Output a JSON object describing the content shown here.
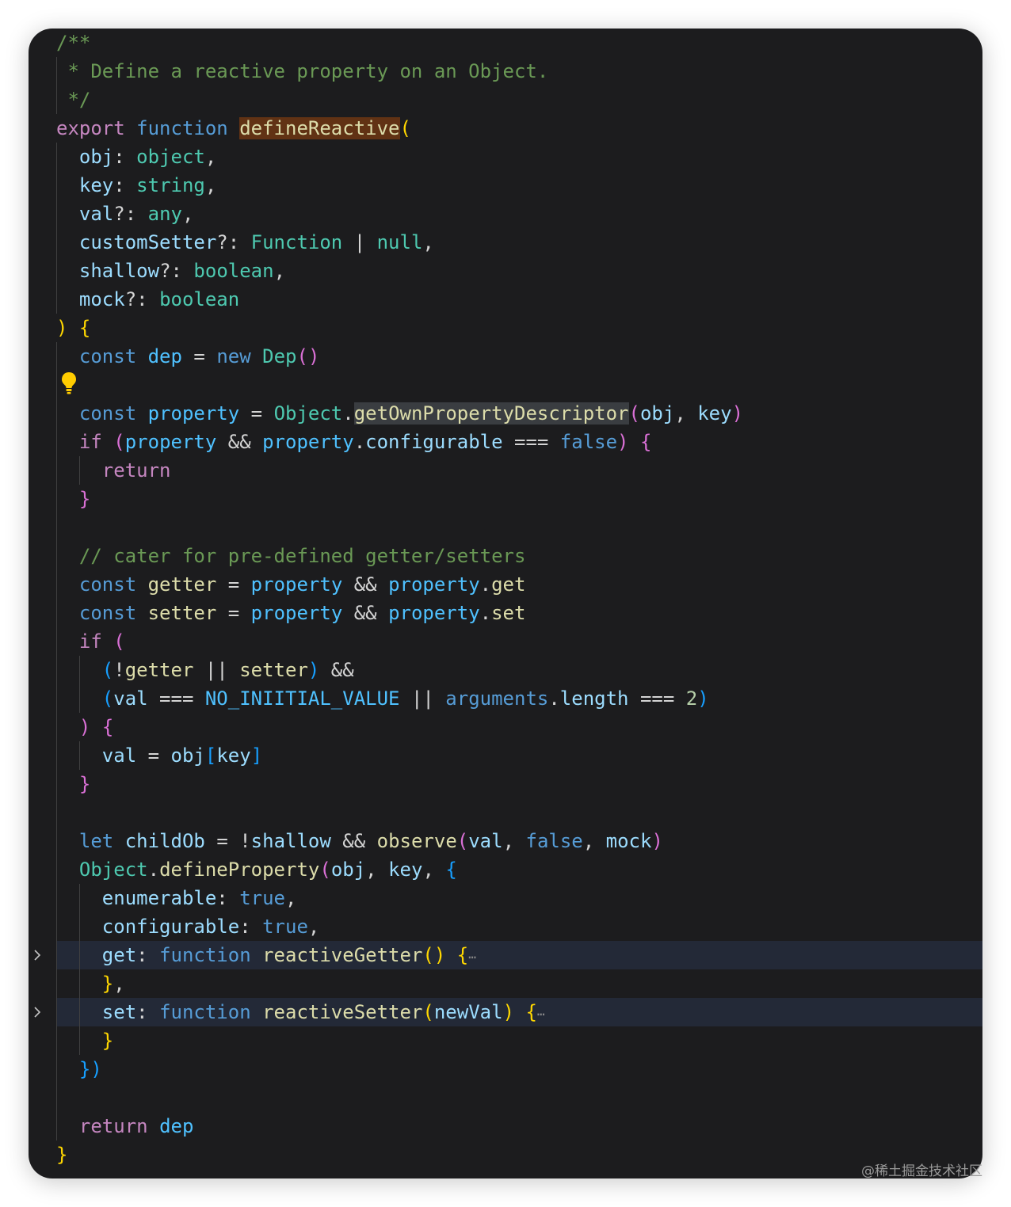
{
  "editor": {
    "background": "#1c1c1e",
    "lines": [
      [
        [
          "/**",
          "cm"
        ]
      ],
      [
        [
          " * Define a reactive property on an Object.",
          "cm"
        ]
      ],
      [
        [
          " */",
          "cm"
        ]
      ],
      [
        [
          "export",
          "kw"
        ],
        [
          " ",
          "pu"
        ],
        [
          "function",
          "st"
        ],
        [
          " ",
          "pu"
        ],
        [
          "defineReactive",
          "fn hl-def"
        ],
        [
          "(",
          "b1"
        ]
      ],
      [
        [
          "  ",
          "pu"
        ],
        [
          "obj",
          "vr"
        ],
        [
          ": ",
          "pu"
        ],
        [
          "object",
          "ty"
        ],
        [
          ",",
          "pu"
        ]
      ],
      [
        [
          "  ",
          "pu"
        ],
        [
          "key",
          "vr"
        ],
        [
          ": ",
          "pu"
        ],
        [
          "string",
          "ty"
        ],
        [
          ",",
          "pu"
        ]
      ],
      [
        [
          "  ",
          "pu"
        ],
        [
          "val",
          "vr"
        ],
        [
          "?: ",
          "pu"
        ],
        [
          "any",
          "ty"
        ],
        [
          ",",
          "pu"
        ]
      ],
      [
        [
          "  ",
          "pu"
        ],
        [
          "customSetter",
          "vr"
        ],
        [
          "?: ",
          "pu"
        ],
        [
          "Function",
          "ty"
        ],
        [
          " | ",
          "pu"
        ],
        [
          "null",
          "ty"
        ],
        [
          ",",
          "pu"
        ]
      ],
      [
        [
          "  ",
          "pu"
        ],
        [
          "shallow",
          "vr"
        ],
        [
          "?: ",
          "pu"
        ],
        [
          "boolean",
          "ty"
        ],
        [
          ",",
          "pu"
        ]
      ],
      [
        [
          "  ",
          "pu"
        ],
        [
          "mock",
          "vr"
        ],
        [
          "?: ",
          "pu"
        ],
        [
          "boolean",
          "ty"
        ]
      ],
      [
        [
          ")",
          "b1"
        ],
        [
          " ",
          "pu"
        ],
        [
          "{",
          "b1"
        ]
      ],
      [
        [
          "  ",
          "pu"
        ],
        [
          "const",
          "st"
        ],
        [
          " ",
          "pu"
        ],
        [
          "dep",
          "cn"
        ],
        [
          " = ",
          "pu"
        ],
        [
          "new",
          "st"
        ],
        [
          " ",
          "pu"
        ],
        [
          "Dep",
          "ty"
        ],
        [
          "()",
          "b2"
        ]
      ],
      [],
      [
        [
          "  ",
          "pu"
        ],
        [
          "const",
          "st"
        ],
        [
          " ",
          "pu"
        ],
        [
          "property",
          "cn"
        ],
        [
          " = ",
          "pu"
        ],
        [
          "Object",
          "ty"
        ],
        [
          ".",
          "pu"
        ],
        [
          "getOwnPropertyDescriptor",
          "fn hl-sel"
        ],
        [
          "(",
          "b2"
        ],
        [
          "obj",
          "vr"
        ],
        [
          ", ",
          "pu"
        ],
        [
          "key",
          "vr"
        ],
        [
          ")",
          "b2"
        ]
      ],
      [
        [
          "  ",
          "pu"
        ],
        [
          "if",
          "kw"
        ],
        [
          " ",
          "pu"
        ],
        [
          "(",
          "b2"
        ],
        [
          "property",
          "cn"
        ],
        [
          " && ",
          "pu"
        ],
        [
          "property",
          "cn"
        ],
        [
          ".",
          "pu"
        ],
        [
          "configurable",
          "vr"
        ],
        [
          " === ",
          "pu"
        ],
        [
          "false",
          "st"
        ],
        [
          ")",
          "b2"
        ],
        [
          " ",
          "pu"
        ],
        [
          "{",
          "b2"
        ]
      ],
      [
        [
          "    ",
          "pu"
        ],
        [
          "return",
          "kw"
        ]
      ],
      [
        [
          "  ",
          "pu"
        ],
        [
          "}",
          "b2"
        ]
      ],
      [],
      [
        [
          "  ",
          "pu"
        ],
        [
          "// cater for pre-defined getter/setters",
          "cm"
        ]
      ],
      [
        [
          "  ",
          "pu"
        ],
        [
          "const",
          "st"
        ],
        [
          " ",
          "pu"
        ],
        [
          "getter",
          "fn"
        ],
        [
          " = ",
          "pu"
        ],
        [
          "property",
          "cn"
        ],
        [
          " && ",
          "pu"
        ],
        [
          "property",
          "cn"
        ],
        [
          ".",
          "pu"
        ],
        [
          "get",
          "fn"
        ]
      ],
      [
        [
          "  ",
          "pu"
        ],
        [
          "const",
          "st"
        ],
        [
          " ",
          "pu"
        ],
        [
          "setter",
          "fn"
        ],
        [
          " = ",
          "pu"
        ],
        [
          "property",
          "cn"
        ],
        [
          " && ",
          "pu"
        ],
        [
          "property",
          "cn"
        ],
        [
          ".",
          "pu"
        ],
        [
          "set",
          "fn"
        ]
      ],
      [
        [
          "  ",
          "pu"
        ],
        [
          "if",
          "kw"
        ],
        [
          " ",
          "pu"
        ],
        [
          "(",
          "b2"
        ]
      ],
      [
        [
          "    ",
          "pu"
        ],
        [
          "(",
          "b3"
        ],
        [
          "!",
          "pu"
        ],
        [
          "getter",
          "fn"
        ],
        [
          " || ",
          "pu"
        ],
        [
          "setter",
          "fn"
        ],
        [
          ")",
          "b3"
        ],
        [
          " &&",
          "pu"
        ]
      ],
      [
        [
          "    ",
          "pu"
        ],
        [
          "(",
          "b3"
        ],
        [
          "val",
          "vr"
        ],
        [
          " === ",
          "pu"
        ],
        [
          "NO_INIITIAL_VALUE",
          "cn"
        ],
        [
          " || ",
          "pu"
        ],
        [
          "arguments",
          "st"
        ],
        [
          ".",
          "pu"
        ],
        [
          "length",
          "vr"
        ],
        [
          " === ",
          "pu"
        ],
        [
          "2",
          "nu"
        ],
        [
          ")",
          "b3"
        ]
      ],
      [
        [
          "  ",
          "pu"
        ],
        [
          ")",
          "b2"
        ],
        [
          " ",
          "pu"
        ],
        [
          "{",
          "b2"
        ]
      ],
      [
        [
          "    ",
          "pu"
        ],
        [
          "val",
          "vr"
        ],
        [
          " = ",
          "pu"
        ],
        [
          "obj",
          "vr"
        ],
        [
          "[",
          "b3"
        ],
        [
          "key",
          "vr"
        ],
        [
          "]",
          "b3"
        ]
      ],
      [
        [
          "  ",
          "pu"
        ],
        [
          "}",
          "b2"
        ]
      ],
      [],
      [
        [
          "  ",
          "pu"
        ],
        [
          "let",
          "st"
        ],
        [
          " ",
          "pu"
        ],
        [
          "childOb",
          "vr"
        ],
        [
          " = !",
          "pu"
        ],
        [
          "shallow",
          "vr"
        ],
        [
          " && ",
          "pu"
        ],
        [
          "observe",
          "fn"
        ],
        [
          "(",
          "b2"
        ],
        [
          "val",
          "vr"
        ],
        [
          ", ",
          "pu"
        ],
        [
          "false",
          "st"
        ],
        [
          ", ",
          "pu"
        ],
        [
          "mock",
          "vr"
        ],
        [
          ")",
          "b2"
        ]
      ],
      [
        [
          "  ",
          "pu"
        ],
        [
          "Object",
          "ty"
        ],
        [
          ".",
          "pu"
        ],
        [
          "defineProperty",
          "fn"
        ],
        [
          "(",
          "b2"
        ],
        [
          "obj",
          "vr"
        ],
        [
          ", ",
          "pu"
        ],
        [
          "key",
          "vr"
        ],
        [
          ", ",
          "pu"
        ],
        [
          "{",
          "b3"
        ]
      ],
      [
        [
          "    ",
          "pu"
        ],
        [
          "enumerable",
          "vr"
        ],
        [
          ": ",
          "pu"
        ],
        [
          "true",
          "st"
        ],
        [
          ",",
          "pu"
        ]
      ],
      [
        [
          "    ",
          "pu"
        ],
        [
          "configurable",
          "vr"
        ],
        [
          ": ",
          "pu"
        ],
        [
          "true",
          "st"
        ],
        [
          ",",
          "pu"
        ]
      ],
      [
        [
          "    ",
          "pu"
        ],
        [
          "get",
          "vr"
        ],
        [
          ": ",
          "pu"
        ],
        [
          "function",
          "st"
        ],
        [
          " ",
          "pu"
        ],
        [
          "reactiveGetter",
          "fn"
        ],
        [
          "()",
          "b1"
        ],
        [
          " ",
          "pu"
        ],
        [
          "{",
          "b1"
        ],
        [
          "⋯",
          "ellipsis"
        ]
      ],
      [
        [
          "    ",
          "pu"
        ],
        [
          "}",
          "b1"
        ],
        [
          ",",
          "pu"
        ]
      ],
      [
        [
          "    ",
          "pu"
        ],
        [
          "set",
          "vr"
        ],
        [
          ": ",
          "pu"
        ],
        [
          "function",
          "st"
        ],
        [
          " ",
          "pu"
        ],
        [
          "reactiveSetter",
          "fn"
        ],
        [
          "(",
          "b1"
        ],
        [
          "newVal",
          "vr"
        ],
        [
          ")",
          "b1"
        ],
        [
          " ",
          "pu"
        ],
        [
          "{",
          "b1"
        ],
        [
          "⋯",
          "ellipsis"
        ]
      ],
      [
        [
          "    ",
          "pu"
        ],
        [
          "}",
          "b1"
        ]
      ],
      [
        [
          "  ",
          "pu"
        ],
        [
          "})",
          "b3"
        ]
      ],
      [],
      [
        [
          "  ",
          "pu"
        ],
        [
          "return",
          "kw"
        ],
        [
          " ",
          "pu"
        ],
        [
          "dep",
          "cn"
        ]
      ],
      [
        [
          "}",
          "b1"
        ]
      ]
    ],
    "folded_lines": [
      32,
      34
    ],
    "lightbulb_line": 12
  },
  "icons": {
    "fold": "chevron-right-icon",
    "lightbulb": "lightbulb-icon"
  },
  "watermark": "@稀土掘金技术社区"
}
